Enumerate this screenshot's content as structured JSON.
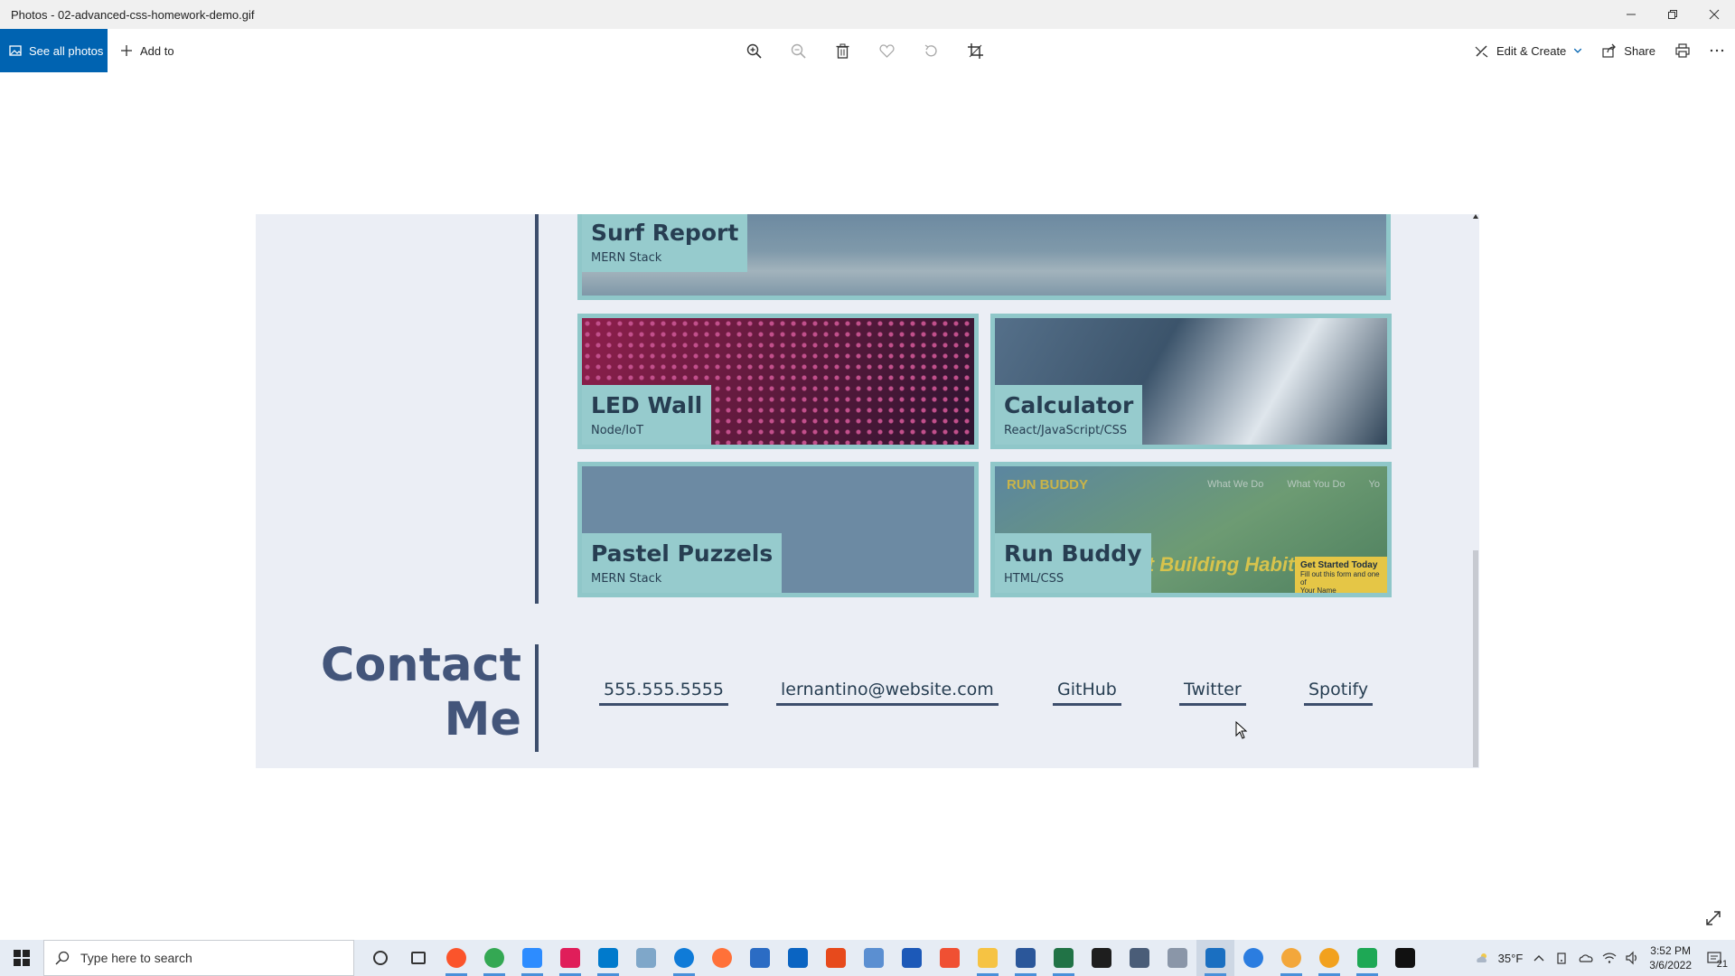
{
  "window": {
    "title": "Photos - 02-advanced-css-homework-demo.gif"
  },
  "toolbar": {
    "see_all_label": "See all photos",
    "add_to_label": "Add to",
    "edit_create_label": "Edit & Create",
    "share_label": "Share"
  },
  "gif": {
    "projects": [
      {
        "name": "Surf Report",
        "tech": "MERN Stack"
      },
      {
        "name": "LED Wall",
        "tech": "Node/IoT"
      },
      {
        "name": "Calculator",
        "tech": "React/JavaScript/CSS"
      },
      {
        "name": "Pastel Puzzels",
        "tech": "MERN Stack"
      },
      {
        "name": "Run Buddy",
        "tech": "HTML/CSS"
      }
    ],
    "run_buddy_preview": {
      "brand": "RUN BUDDY",
      "nav": [
        "What We Do",
        "What You Do",
        "Yo"
      ],
      "headline": "art Building Habits",
      "cta_title": "Get Started Today",
      "cta_sub": "Fill out this form and one of",
      "cta_field": "Your Name"
    },
    "contact": {
      "heading_line1": "Contact",
      "heading_line2": "Me",
      "links": [
        "555.555.5555",
        "lernantino@website.com",
        "GitHub",
        "Twitter",
        "Spotify"
      ]
    }
  },
  "taskbar": {
    "search_placeholder": "Type here to search",
    "weather": "35°F",
    "time": "3:52 PM",
    "date": "3/6/2022",
    "notifications": "21",
    "app_icons": [
      {
        "name": "cortana-icon",
        "color": "#333333"
      },
      {
        "name": "task-view-icon",
        "color": "#333333"
      },
      {
        "name": "brave-icon",
        "color": "#fb542b"
      },
      {
        "name": "chrome-icon",
        "color": "#34a853"
      },
      {
        "name": "zoom-icon",
        "color": "#2d8cff"
      },
      {
        "name": "slack-icon",
        "color": "#e01e5a"
      },
      {
        "name": "vscode-icon",
        "color": "#007acc"
      },
      {
        "name": "notepad-icon",
        "color": "#7fa7c9"
      },
      {
        "name": "edge-icon",
        "color": "#0f7bd8"
      },
      {
        "name": "firefox-icon",
        "color": "#ff7139"
      },
      {
        "name": "store-icon",
        "color": "#2b6cc4"
      },
      {
        "name": "mail-icon",
        "color": "#0a64c2"
      },
      {
        "name": "office-icon",
        "color": "#e74a1c"
      },
      {
        "name": "control-panel-icon",
        "color": "#5b8fd1"
      },
      {
        "name": "azure-icon",
        "color": "#1c59b8"
      },
      {
        "name": "git-icon",
        "color": "#f05033"
      },
      {
        "name": "file-explorer-icon",
        "color": "#f6c343"
      },
      {
        "name": "word-icon",
        "color": "#2b579a"
      },
      {
        "name": "excel-icon",
        "color": "#217346"
      },
      {
        "name": "terminal-icon",
        "color": "#1e1e1e"
      },
      {
        "name": "calculator-icon",
        "color": "#4a5d78"
      },
      {
        "name": "ime-icon",
        "color": "#8a96a8"
      },
      {
        "name": "photos-icon",
        "color": "#1a6fc1"
      },
      {
        "name": "sync-icon",
        "color": "#2b7de0"
      },
      {
        "name": "chat-icon",
        "color": "#f3a73b"
      },
      {
        "name": "e-app-icon",
        "color": "#f2a11e"
      },
      {
        "name": "linux-icon",
        "color": "#1ea855"
      },
      {
        "name": "cmd-icon",
        "color": "#111111"
      }
    ]
  }
}
